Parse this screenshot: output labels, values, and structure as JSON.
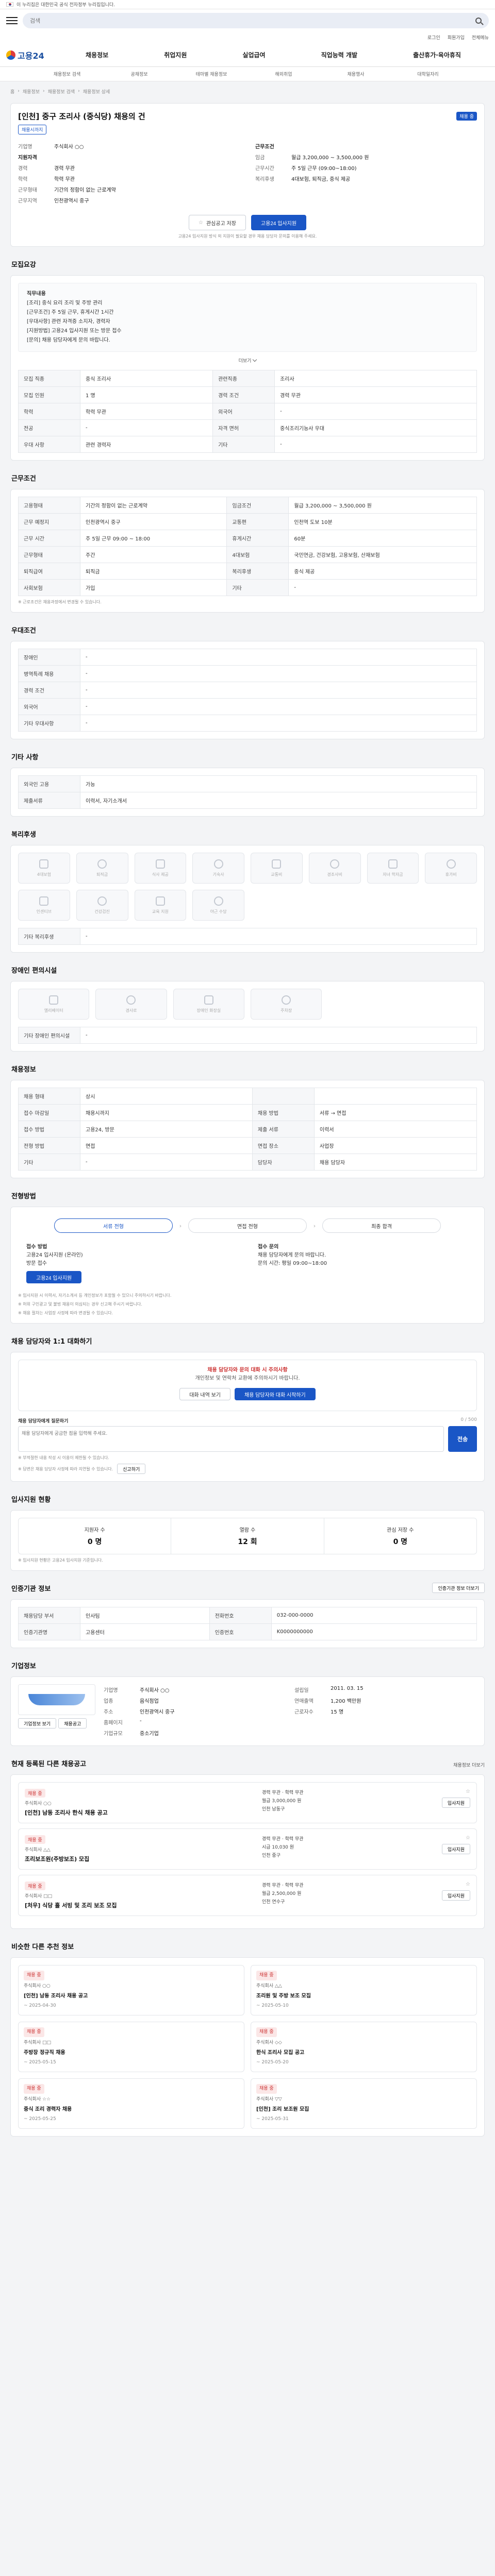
{
  "gov_bar": {
    "text": "이 누리집은 대한민국 공식 전자정부 누리집입니다."
  },
  "search": {
    "placeholder": "검색"
  },
  "util": {
    "login": "로그인",
    "join": "회원가입",
    "sitemap": "전체메뉴"
  },
  "logo": {
    "name": "고용24"
  },
  "nav": [
    "채용정보",
    "취업지원",
    "실업급여",
    "직업능력 개발",
    "출산휴가·육아휴직"
  ],
  "sub_nav": [
    "채용정보 검색",
    "공채정보",
    "테마별 채용정보",
    "해외취업",
    "채용행사",
    "대학일자리"
  ],
  "breadcrumb": [
    "홈",
    "채용정보",
    "채용정보 검색",
    "채용정보 상세"
  ],
  "job": {
    "title": "[인천] 중구 조리사 (중식당) 채용의 건",
    "badge_status": "채용 중",
    "badge_deadline": "채용시까지",
    "company_label": "기업명",
    "company": "주식회사 ○○",
    "left": [
      {
        "k": "지원자격",
        "v": ""
      },
      {
        "k": "경력",
        "v": "경력 무관"
      },
      {
        "k": "학력",
        "v": "학력 무관"
      },
      {
        "k": "근무형태",
        "v": "기간의 정함이 없는 근로계약"
      },
      {
        "k": "근무지역",
        "v": "인천광역시 중구"
      }
    ],
    "right": [
      {
        "k": "근무조건",
        "v": ""
      },
      {
        "k": "임금",
        "v": "월급 3,200,000 ~ 3,500,000 원"
      },
      {
        "k": "근무시간",
        "v": "주 5일 근무 (09:00~18:00)"
      },
      {
        "k": "복리후생",
        "v": "4대보험, 퇴직금, 중식 제공"
      }
    ],
    "btn_scrap": "관심공고 저장",
    "btn_apply": "고용24 입사지원",
    "note": "고용24 입사지원 방식 외 지원이 필요할 경우 채용 담당자 문의를 이용해 주세요."
  },
  "s_recruit": {
    "title": "모집요강",
    "desc_lines": [
      "직무내용",
      "[조리] 중식 요리 조리 및 주방 관리",
      "[근무조건] 주 5일 근무, 휴게시간 1시간",
      "[우대사항] 관련 자격증 소지자, 경력자",
      "[지원방법] 고용24 입사지원 또는 방문 접수",
      "[문의] 채용 담당자에게 문의 바랍니다."
    ],
    "more": "더보기",
    "rows": [
      [
        "모집 직종",
        "중식 조리사",
        "관련직종",
        "조리사"
      ],
      [
        "모집 인원",
        "1 명",
        "경력 조건",
        "경력 무관"
      ],
      [
        "학력",
        "학력 무관",
        "외국어",
        "-"
      ],
      [
        "전공",
        "-",
        "자격 면허",
        "중식조리기능사 우대"
      ],
      [
        "우대 사항",
        "관련 경력자",
        "기타",
        "-"
      ]
    ]
  },
  "s_conditions": {
    "title": "근무조건",
    "rows": [
      [
        "고용형태",
        "기간의 정함이 없는 근로계약",
        "임금조건",
        "월급 3,200,000 ~ 3,500,000 원"
      ],
      [
        "근무 예정지",
        "인천광역시 중구",
        "교통편",
        "인천역 도보 10분"
      ],
      [
        "근무 시간",
        "주 5일 근무 09:00 ~ 18:00",
        "휴게시간",
        "60분"
      ],
      [
        "근무형태",
        "주간",
        "4대보험",
        "국민연금, 건강보험, 고용보험, 산재보험"
      ],
      [
        "퇴직급여",
        "퇴직금",
        "복리후생",
        "중식 제공"
      ],
      [
        "사회보험",
        "가입",
        "기타",
        "-"
      ]
    ],
    "note": "※ 근로조건은 채용과정에서 변경될 수 있습니다."
  },
  "s_disabled": {
    "title": "우대조건",
    "rows": [
      [
        "장애인",
        "-"
      ],
      [
        "병역특례 채용",
        "-"
      ],
      [
        "경력 조건",
        "-"
      ],
      [
        "외국어",
        "-"
      ],
      [
        "기타 우대사항",
        "-"
      ]
    ]
  },
  "s_other": {
    "title": "기타 사항",
    "rows": [
      [
        "외국인 고용",
        "가능"
      ],
      [
        "제출서류",
        "이력서, 자기소개서"
      ]
    ]
  },
  "s_welfare": {
    "title": "복리후생",
    "icons": [
      "4대보험",
      "퇴직금",
      "식사 제공",
      "기숙사",
      "교통비",
      "경조사비",
      "자녀 학자금",
      "휴가비",
      "인센티브",
      "건강검진",
      "교육 지원",
      "야근 수당"
    ],
    "etc_label": "기타 복리후생",
    "etc_value": "-"
  },
  "s_facility": {
    "title": "장애인 편의시설",
    "icons": [
      "엘리베이터",
      "경사로",
      "장애인 화장실",
      "주차장"
    ],
    "etc_label": "기타 장애인 편의시설",
    "etc_value": "-"
  },
  "s_recruit_info": {
    "title": "채용정보",
    "rows": [
      [
        "채용 형태",
        "상시",
        "",
        ""
      ],
      [
        "접수 마감일",
        "채용시까지",
        "채용 방법",
        "서류 → 면접"
      ],
      [
        "접수 방법",
        "고용24, 방문",
        "제출 서류",
        "이력서"
      ],
      [
        "전형 방법",
        "면접",
        "면접 장소",
        "사업장"
      ],
      [
        "기타",
        "-",
        "담당자",
        "채용 담당자"
      ]
    ]
  },
  "s_process": {
    "title": "전형방법",
    "steps": [
      "서류 전형",
      "면접 전형",
      "최종 합격"
    ],
    "apply_title": "접수 방법",
    "apply_lines": [
      "고용24 입사지원 (온라인)",
      "방문 접수"
    ],
    "apply_btn": "고용24 입사지원",
    "contact_title": "접수 문의",
    "contact_lines": [
      "채용 담당자에게 문의 바랍니다.",
      "문의 시간: 평일 09:00~18:00"
    ],
    "notes": [
      "※ 입사지원 시 이력서, 자기소개서 등 개인정보가 포함될 수 있으니 주의하시기 바랍니다.",
      "※ 허위 구인광고 및 불법 채용이 의심되는 경우 신고해 주시기 바랍니다.",
      "※ 채용 절차는 사업장 사정에 따라 변경될 수 있습니다."
    ]
  },
  "s_chat": {
    "title": "채용 담당자와 1:1 대화하기",
    "alert1": "채용 담당자와 문의 대화 시 주의사항",
    "alert2": "개인정보 및 연락처 교환에 주의하시기 바랍니다.",
    "btn_history": "대화 내역 보기",
    "btn_start": "채용 담당자와 대화 시작하기",
    "label": "채용 담당자에게 질문하기",
    "counter": "0 / 500",
    "placeholder": "채용 담당자에게 궁금한 점을 입력해 주세요.",
    "send": "전송",
    "notes": [
      "※ 부적절한 내용 작성 시 이용이 제한될 수 있습니다.",
      "※ 답변은 채용 담당자 사정에 따라 지연될 수 있습니다."
    ],
    "report_btn": "신고하기"
  },
  "s_stats": {
    "title": "입사지원 현황",
    "items": [
      {
        "label": "지원자 수",
        "value": "0 명"
      },
      {
        "label": "열람 수",
        "value": "12 회"
      },
      {
        "label": "관심 저장 수",
        "value": "0 명"
      }
    ],
    "note": "※ 입사지원 현황은 고용24 입사지원 기준입니다."
  },
  "s_manager": {
    "title": "인증기관 정보",
    "btn": "인증기관 정보 더보기",
    "rows": [
      [
        "채용담당 부서",
        "인사팀",
        "전화번호",
        "032-000-0000"
      ],
      [
        "인증기관명",
        "고용센터",
        "인증번호",
        "K0000000000"
      ]
    ]
  },
  "s_company": {
    "title": "기업정보",
    "btn_more": "기업정보 보기",
    "btn_list": "채용공고",
    "left": [
      {
        "k": "기업명",
        "v": "주식회사 ○○"
      },
      {
        "k": "업종",
        "v": "음식점업"
      },
      {
        "k": "주소",
        "v": "인천광역시 중구"
      },
      {
        "k": "홈페이지",
        "v": "-"
      },
      {
        "k": "기업규모",
        "v": "중소기업"
      }
    ],
    "right": [
      {
        "k": "설립일",
        "v": "2011. 03. 15"
      },
      {
        "k": "연매출액",
        "v": "1,200 백만원"
      },
      {
        "k": "근로자수",
        "v": "15 명"
      }
    ]
  },
  "s_similar": {
    "title": "현재 등록된 다른 채용공고",
    "link": "채용정보 더보기",
    "items": [
      {
        "tag": "채용 중",
        "company": "주식회사 ○○",
        "title": "[인천] 남동 조리사 한식 채용 공고",
        "info": [
          "경력 무관 · 학력 무관",
          "월급 3,000,000 원",
          "인천 남동구"
        ],
        "btn": "입사지원"
      },
      {
        "tag": "채용 중",
        "company": "주식회사 △△",
        "title": "조리보조원(주방보조) 모집",
        "info": [
          "경력 무관 · 학력 무관",
          "시급 10,030 원",
          "인천 중구"
        ],
        "btn": "입사지원"
      },
      {
        "tag": "채용 중",
        "company": "주식회사 □□",
        "title": "[처우] 식당 홀 서빙 및 조리 보조 모집",
        "info": [
          "경력 무관 · 학력 무관",
          "월급 2,500,000 원",
          "인천 연수구"
        ],
        "btn": "입사지원"
      }
    ]
  },
  "s_similar2": {
    "title": "비슷한 다른 추천 정보",
    "items": [
      {
        "tag": "채용 중",
        "company": "주식회사 ○○",
        "title": "[인천] 남동 조리사 채용 공고",
        "date": "~ 2025-04-30"
      },
      {
        "tag": "채용 중",
        "company": "주식회사 △△",
        "title": "조리원 및 주방 보조 모집",
        "date": "~ 2025-05-10"
      },
      {
        "tag": "채용 중",
        "company": "주식회사 □□",
        "title": "주방장 정규직 채용",
        "date": "~ 2025-05-15"
      },
      {
        "tag": "채용 중",
        "company": "주식회사 ◇◇",
        "title": "한식 조리사 모집 공고",
        "date": "~ 2025-05-20"
      },
      {
        "tag": "채용 중",
        "company": "주식회사 ☆☆",
        "title": "중식 조리 경력자 채용",
        "date": "~ 2025-05-25"
      },
      {
        "tag": "채용 중",
        "company": "주식회사 ▽▽",
        "title": "[인천] 조리 보조원 모집",
        "date": "~ 2025-05-31"
      }
    ]
  }
}
